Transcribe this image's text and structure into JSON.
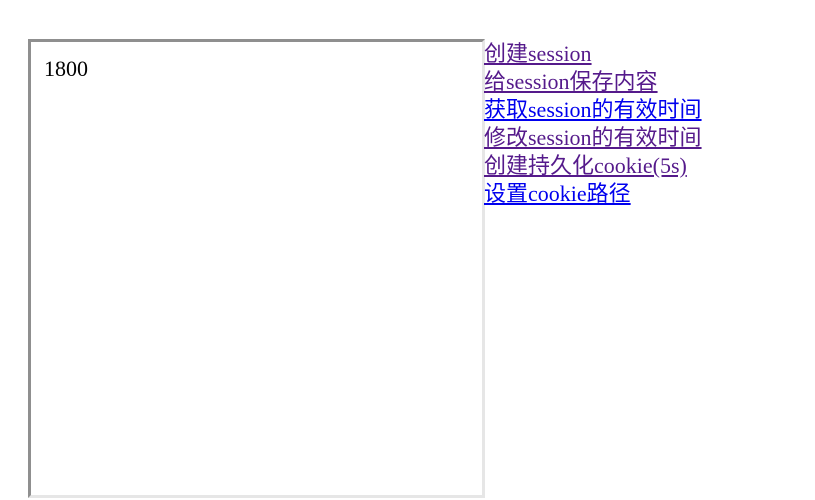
{
  "iframe": {
    "content": "1800"
  },
  "links": [
    {
      "label": "创建session",
      "visited": true
    },
    {
      "label": "给session保存内容",
      "visited": true
    },
    {
      "label": "获取session的有效时间",
      "visited": false
    },
    {
      "label": "修改session的有效时间",
      "visited": true
    },
    {
      "label": "创建持久化cookie(5s)",
      "visited": true
    },
    {
      "label": "设置cookie路径",
      "visited": false
    }
  ],
  "colors": {
    "visited_link": "#551a8b",
    "unvisited_link": "#0000ee",
    "frame_border_dark": "#8f8f8f",
    "frame_border_light": "#e6e6e6"
  }
}
